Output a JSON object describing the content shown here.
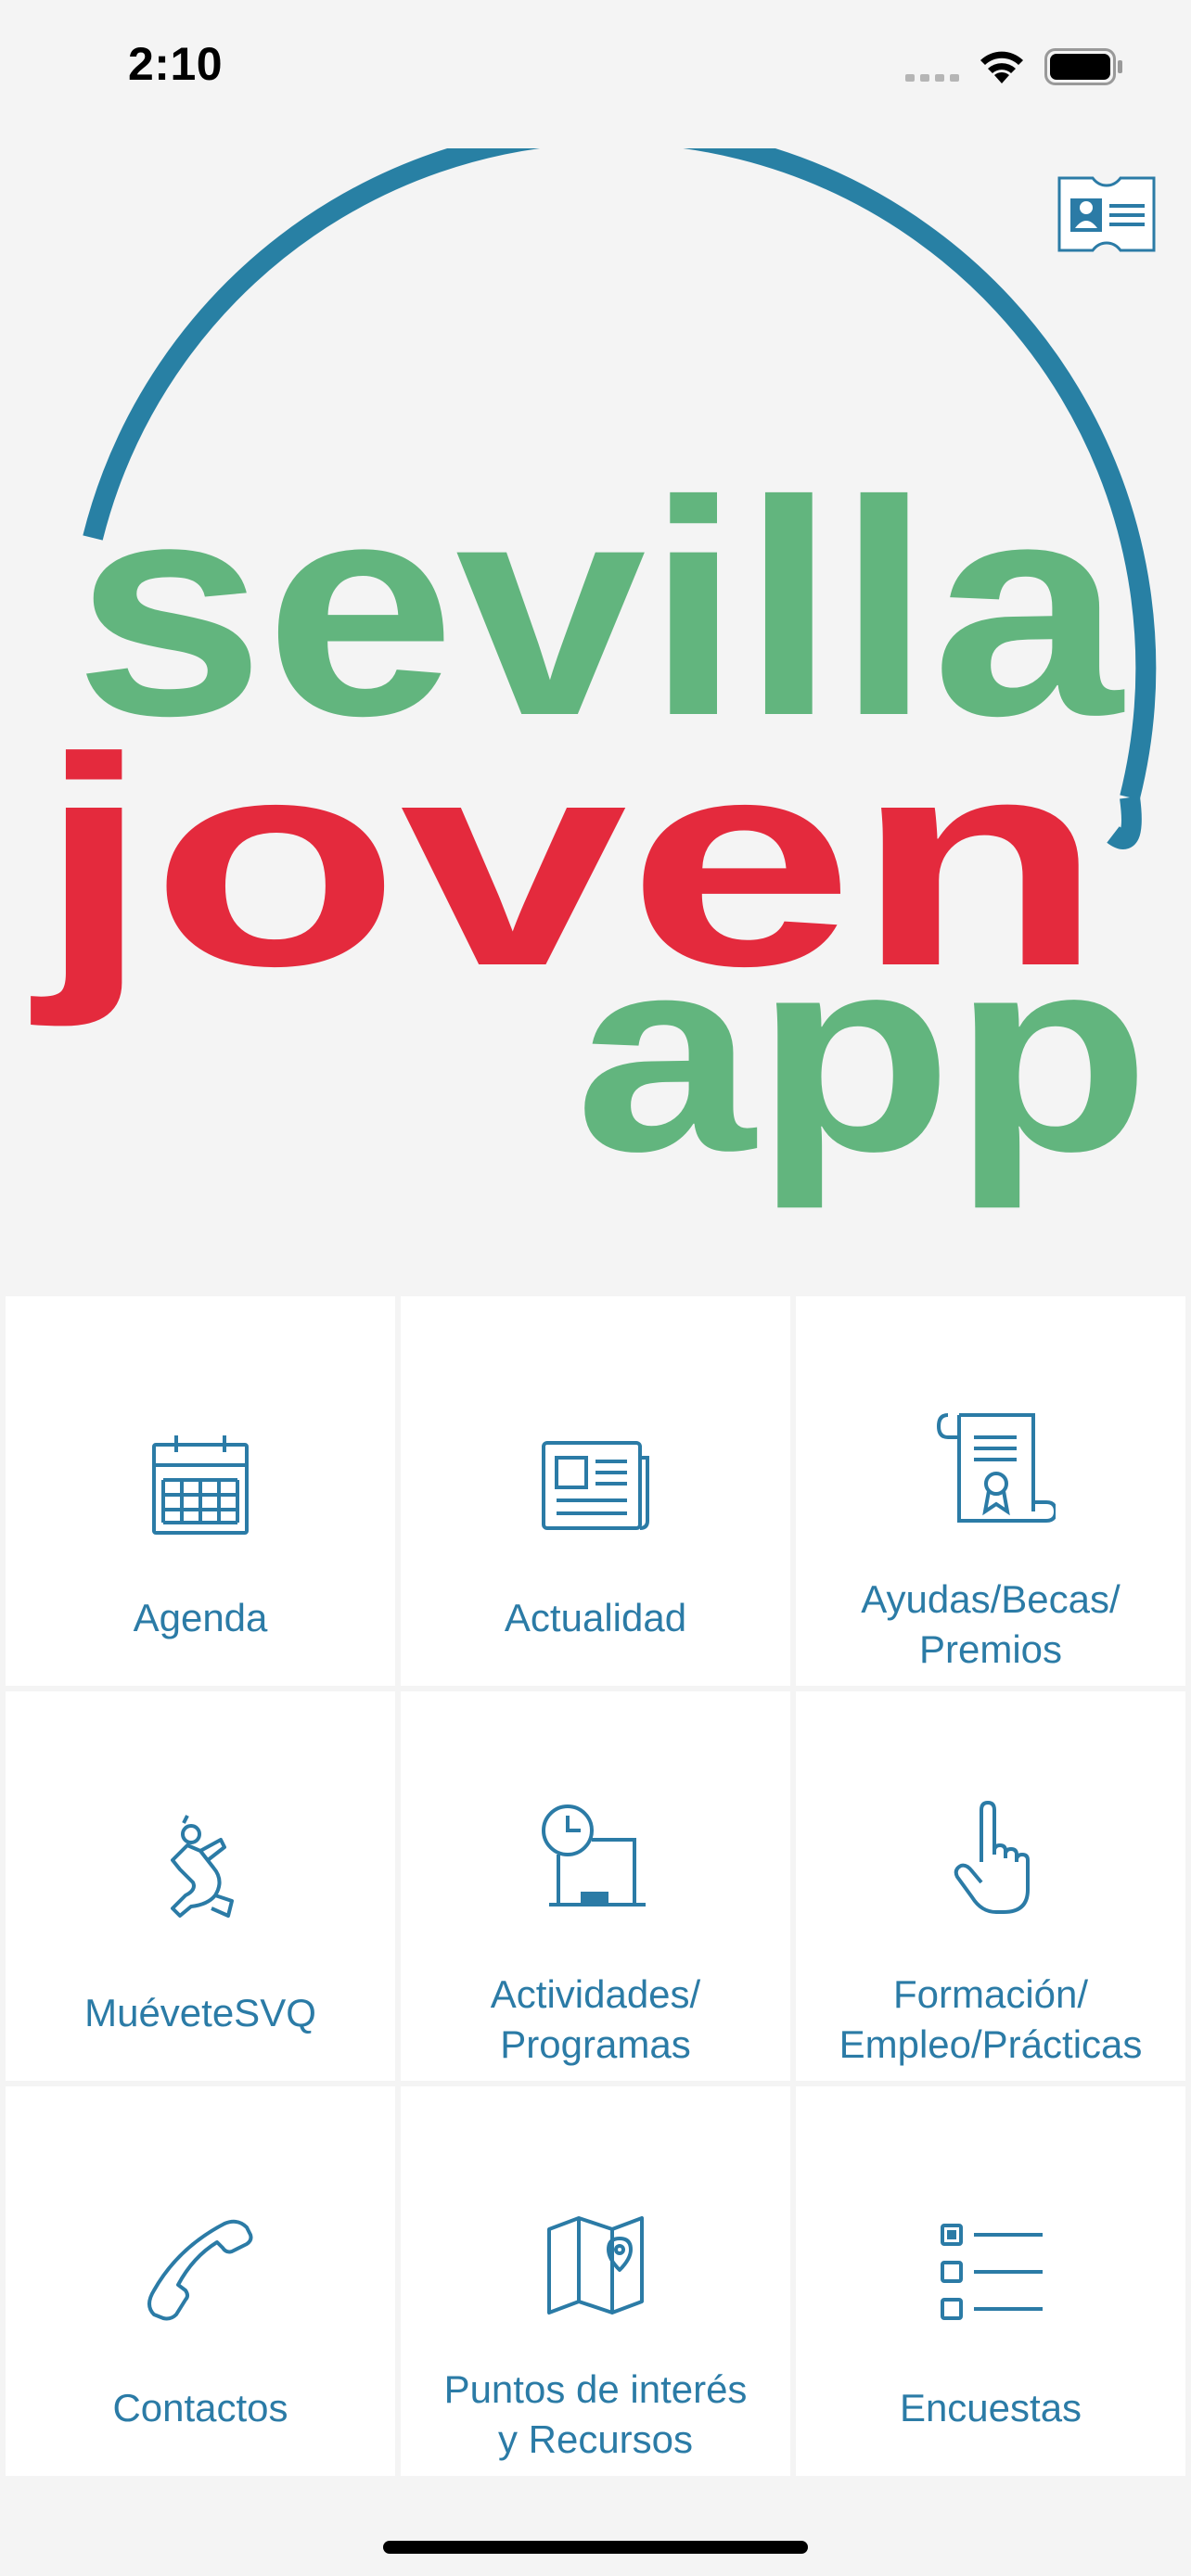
{
  "status_bar": {
    "time": "2:10"
  },
  "logo": {
    "line1": "sevilla",
    "line2": "joven",
    "line3": "app",
    "colors": {
      "arc": "#2880a4",
      "green": "#62b57e",
      "red": "#e42a3d"
    }
  },
  "menu": {
    "items": [
      {
        "label": "Agenda",
        "icon": "calendar-icon"
      },
      {
        "label": "Actualidad",
        "icon": "newspaper-icon"
      },
      {
        "label": "Ayudas/Becas/\nPremios",
        "icon": "certificate-scroll-icon"
      },
      {
        "label": "MuéveteSVQ",
        "icon": "running-figure-icon"
      },
      {
        "label": "Actividades/\nProgramas",
        "icon": "clock-board-icon"
      },
      {
        "label": "Formación/\nEmpleo/Prácticas",
        "icon": "pointing-hand-icon"
      },
      {
        "label": "Contactos",
        "icon": "phone-icon"
      },
      {
        "label": "Puntos de interés\ny Recursos",
        "icon": "map-pin-icon"
      },
      {
        "label": "Encuestas",
        "icon": "checklist-icon"
      }
    ]
  },
  "colors": {
    "accent": "#2b7ba6",
    "tile_background": "#ffffff",
    "page_background": "#f4f4f4"
  }
}
